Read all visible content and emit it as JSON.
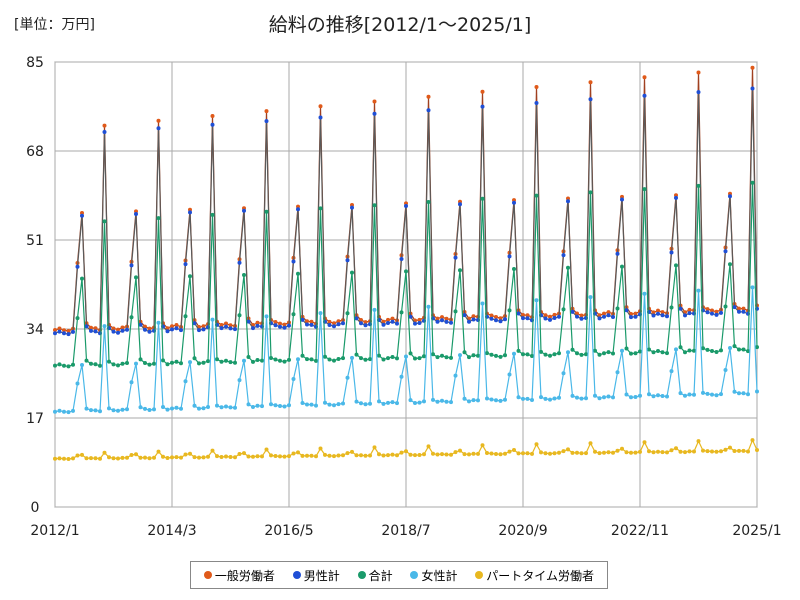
{
  "chart_data": {
    "type": "line",
    "title": "給料の推移[2012/1～2025/1]",
    "unit_label": "[単位：万円]",
    "x_range": [
      "2012/1",
      "2025/1"
    ],
    "x_tick_labels": [
      "2012/1",
      "2014/3",
      "2016/5",
      "2018/7",
      "2020/9",
      "2022/11",
      "2025/1"
    ],
    "y_ticks": [
      0,
      17,
      34,
      51,
      68,
      85
    ],
    "ylim": [
      0,
      85
    ],
    "grid": true,
    "legend_position": "bottom",
    "series": [
      {
        "name": "一般労働者",
        "color": "#e05a1a",
        "line_color": "#a04020",
        "base": 33.8,
        "jun": 46.5,
        "dec_start": 72,
        "dec_end": 84,
        "jul": 56,
        "trend": 4
      },
      {
        "name": "男性計",
        "color": "#1f4fd6",
        "line_color": "#5a5a5a",
        "base": 33.2,
        "jun": 45.8,
        "dec_start": 71,
        "dec_end": 80,
        "jul": 55.5,
        "trend": 4
      },
      {
        "name": "合計",
        "color": "#1a9a6a",
        "line_color": "#1a9a6a",
        "base": 27.0,
        "jun": 36.0,
        "dec_start": 54,
        "dec_end": 62,
        "jul": 43.5,
        "trend": 3
      },
      {
        "name": "女性計",
        "color": "#4ab8e8",
        "line_color": "#4ab8e8",
        "base": 18.2,
        "jun": 23.5,
        "dec_start": 34,
        "dec_end": 42,
        "jul": 27,
        "trend": 3.5
      },
      {
        "name": "パートタイム労働者",
        "color": "#e8b820",
        "line_color": "#e8b820",
        "base": 9.2,
        "jun": 9.8,
        "dec_start": 10.2,
        "dec_end": 12.8,
        "jul": 9.9,
        "trend": 1.5
      }
    ]
  }
}
